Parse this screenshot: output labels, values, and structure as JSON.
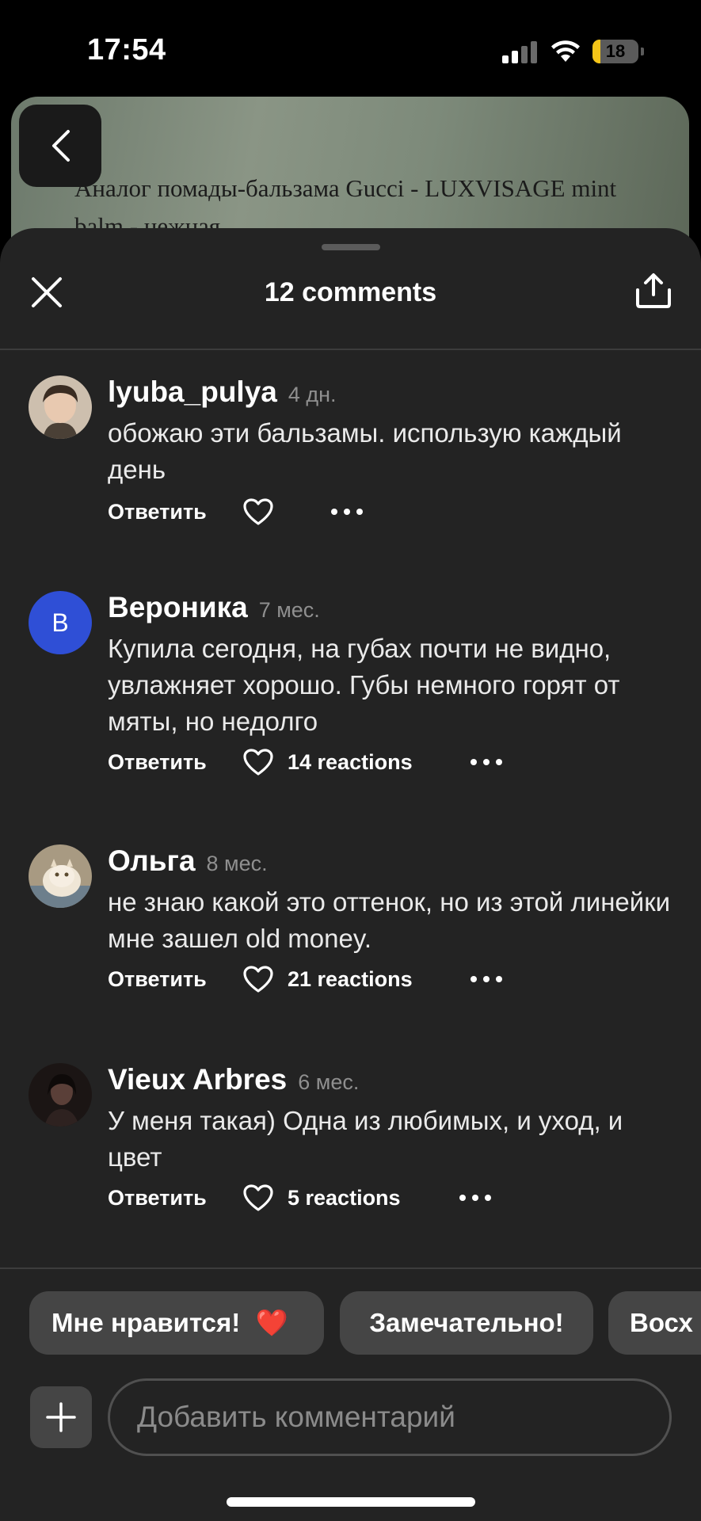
{
  "status_bar": {
    "time": "17:54",
    "battery_level": "18",
    "battery_fraction": 0.18
  },
  "video": {
    "title": "Аналог помады-бальзама Gucci - LUXVISAGE mint balm - нежная"
  },
  "sheet": {
    "title": "12 comments"
  },
  "comments": [
    {
      "author": "lyuba_pulya",
      "age": "4 дн.",
      "text": "обожаю эти бальзамы. использую каждый день",
      "reply": "Ответить",
      "reactions": ""
    },
    {
      "author": "Вероника",
      "age": "7 мес.",
      "avatar_letter": "В",
      "text": "Купила сегодня, на губах почти не видно, увлажняет хорошо. Губы немного горят от мяты, но недолго",
      "reply": "Ответить",
      "reactions": "14 reactions"
    },
    {
      "author": "Ольга",
      "age": "8 мес.",
      "text": "не знаю какой это оттенок, но из этой линейки мне зашел old money.",
      "reply": "Ответить",
      "reactions": "21 reactions"
    },
    {
      "author": "Vieux Arbres",
      "age": "6 мес.",
      "text": "У меня такая) Одна из любимых, и уход, и цвет",
      "reply": "Ответить",
      "reactions": "5 reactions"
    }
  ],
  "quick_replies": [
    {
      "label": "Мне нравится!",
      "emoji": "❤️"
    },
    {
      "label": "Замечательно!"
    },
    {
      "label": "Восх"
    }
  ],
  "composer": {
    "placeholder": "Добавить комментарий"
  },
  "colors": {
    "background": "#000000",
    "sheet": "#232323",
    "chip": "#454545",
    "avatar_letter_bg": "#2f4fd6",
    "battery": "#f5c518"
  }
}
